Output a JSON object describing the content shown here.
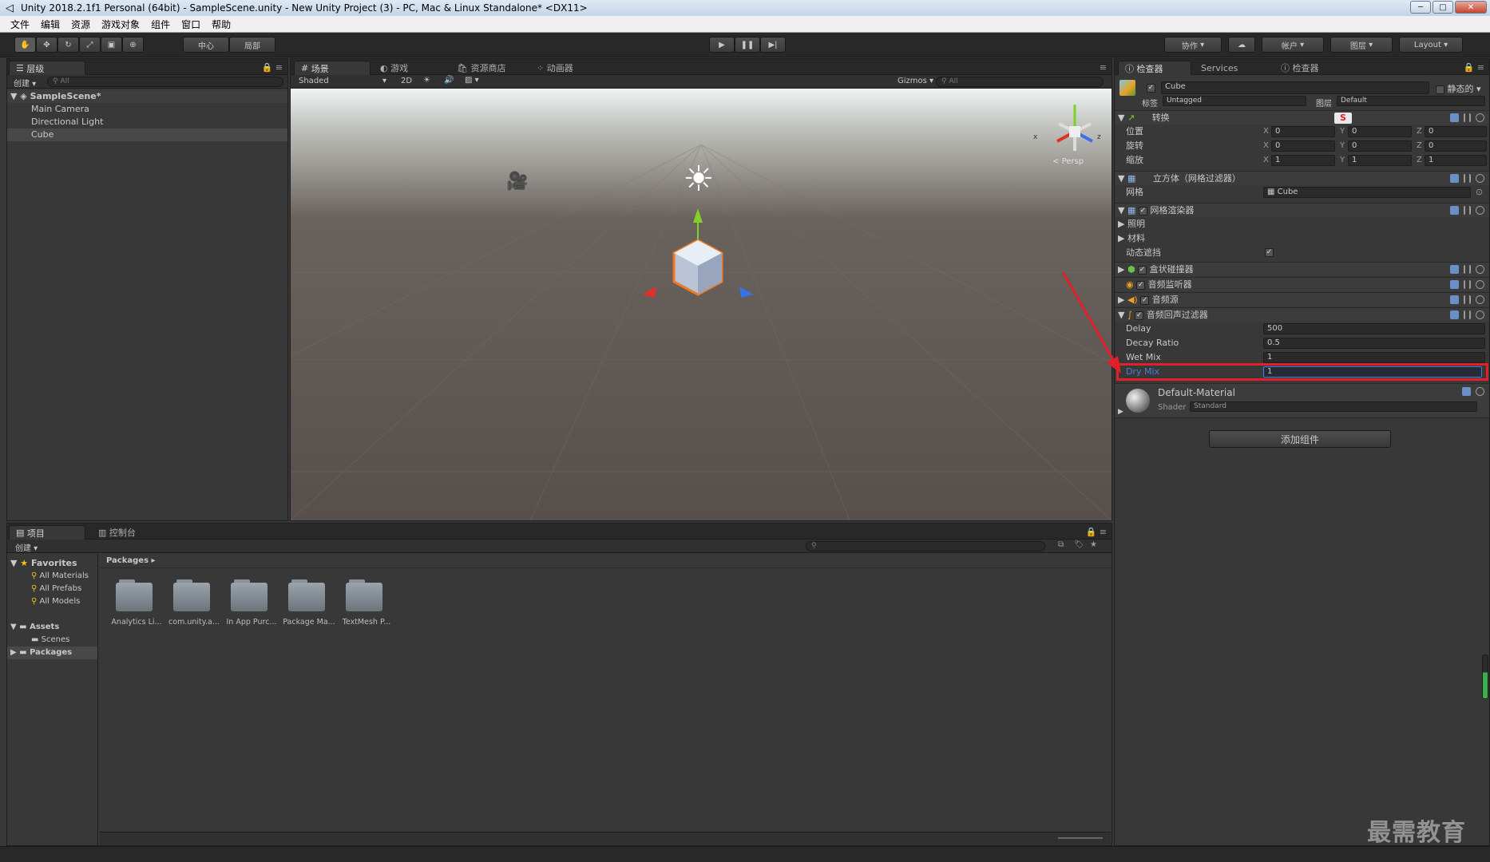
{
  "window": {
    "title": "Unity 2018.2.1f1 Personal (64bit) - SampleScene.unity - New Unity Project (3) - PC, Mac & Linux Standalone* <DX11>"
  },
  "menu": [
    "文件",
    "编辑",
    "资源",
    "游戏对象",
    "组件",
    "窗口",
    "帮助"
  ],
  "toolbar": {
    "pivot": "中心",
    "space": "局部",
    "collab": "协作",
    "account": "帐户",
    "layers": "图层",
    "layout": "Layout"
  },
  "hierarchy": {
    "tab": "层级",
    "create": "创建",
    "search": "All",
    "scene": "SampleScene*",
    "items": [
      "Main Camera",
      "Directional Light",
      "Cube"
    ]
  },
  "scene": {
    "tabs": [
      "场景",
      "游戏",
      "资源商店",
      "动画器"
    ],
    "shading": "Shaded",
    "mode2d": "2D",
    "gizmos": "Gizmos",
    "search": "All",
    "persp": "Persp",
    "axis_x": "x",
    "axis_z": "z"
  },
  "inspector": {
    "tabs": [
      "检查器",
      "Services",
      "检查器"
    ],
    "object_name": "Cube",
    "static_label": "静态的",
    "tag_label": "标签",
    "tag": "Untagged",
    "layer_label": "图层",
    "layer": "Default",
    "transform": {
      "title": "转换",
      "rows": [
        {
          "label": "位置",
          "x": "0",
          "y": "0",
          "z": "0"
        },
        {
          "label": "旋转",
          "x": "0",
          "y": "0",
          "z": "0"
        },
        {
          "label": "缩放",
          "x": "1",
          "y": "1",
          "z": "1"
        }
      ],
      "axes": [
        "X",
        "Y",
        "Z"
      ]
    },
    "mesh_filter": {
      "title": "立方体（网格过滤器）",
      "mesh_label": "网格",
      "mesh": "Cube"
    },
    "mesh_renderer": {
      "title": "网格渲染器",
      "lighting": "照明",
      "materials": "材料",
      "dynamic_occlusion": "动态遮挡"
    },
    "box_collider": {
      "title": "盒状碰撞器"
    },
    "audio_listener": {
      "title": "音频监听器"
    },
    "audio_source": {
      "title": "音频源"
    },
    "echo_filter": {
      "title": "音频回声过滤器",
      "rows": [
        {
          "label": "Delay",
          "value": "500"
        },
        {
          "label": "Decay Ratio",
          "value": "0.5"
        },
        {
          "label": "Wet Mix",
          "value": "1"
        },
        {
          "label": "Dry Mix",
          "value": "1"
        }
      ]
    },
    "material": {
      "name": "Default-Material",
      "shader_label": "Shader",
      "shader": "Standard"
    },
    "add_component": "添加组件"
  },
  "project": {
    "tabs": [
      "项目",
      "控制台"
    ],
    "create": "创建",
    "tree": {
      "favorites": "Favorites",
      "fav_items": [
        "All Materials",
        "All Prefabs",
        "All Models"
      ],
      "assets": "Assets",
      "scenes": "Scenes",
      "packages": "Packages"
    },
    "breadcrumb": "Packages",
    "folders": [
      "Analytics Li...",
      "com.unity.a...",
      "In App Purc...",
      "Package Ma...",
      "TextMesh P..."
    ]
  },
  "watermark": "最需教育",
  "colors": {
    "highlight": "#e0202a",
    "selected_text": "#4a7cd6"
  }
}
